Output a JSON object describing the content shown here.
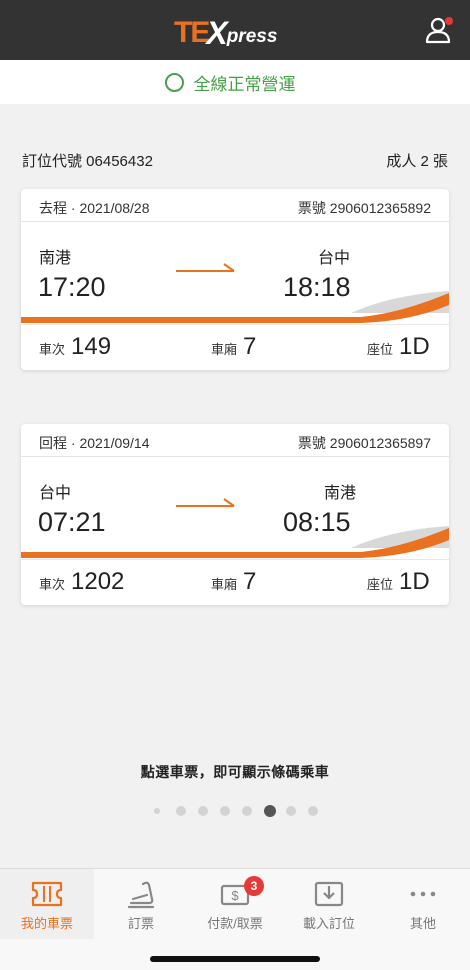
{
  "header": {
    "logo_te": "TE",
    "logo_x": "X",
    "logo_press": "press",
    "user_icon": "user-icon",
    "notification_dot_color": "#e53a35"
  },
  "status": {
    "text": "全線正常營運",
    "color": "#46a047"
  },
  "booking": {
    "code_label": "訂位代號 06456432",
    "passengers": "成人 2 張"
  },
  "tickets": [
    {
      "trip": "去程 · 2021/08/28",
      "ticket_no": "票號 2906012365892",
      "from": "南港",
      "to": "台中",
      "depart": "17:20",
      "arrive": "18:18",
      "train_label": "車次",
      "train": "149",
      "car_label": "車廂",
      "car": "7",
      "seat_label": "座位",
      "seat": "1D"
    },
    {
      "trip": "回程 · 2021/09/14",
      "ticket_no": "票號 2906012365897",
      "from": "台中",
      "to": "南港",
      "depart": "07:21",
      "arrive": "08:15",
      "train_label": "車次",
      "train": "1202",
      "car_label": "車廂",
      "car": "7",
      "seat_label": "座位",
      "seat": "1D"
    }
  ],
  "hint": "點選車票，即可顯示條碼乘車",
  "pager": {
    "count": 8,
    "active_index": 5
  },
  "tabs": [
    {
      "label": "我的車票",
      "icon": "ticket-icon",
      "active": true
    },
    {
      "label": "訂票",
      "icon": "seat-icon",
      "active": false
    },
    {
      "label": "付款/取票",
      "icon": "payment-icon",
      "active": false,
      "badge": "3"
    },
    {
      "label": "載入訂位",
      "icon": "download-icon",
      "active": false
    },
    {
      "label": "其他",
      "icon": "more-icon",
      "active": false
    }
  ],
  "colors": {
    "accent": "#e9711f",
    "status_green": "#46a047",
    "topbar": "#333333"
  }
}
